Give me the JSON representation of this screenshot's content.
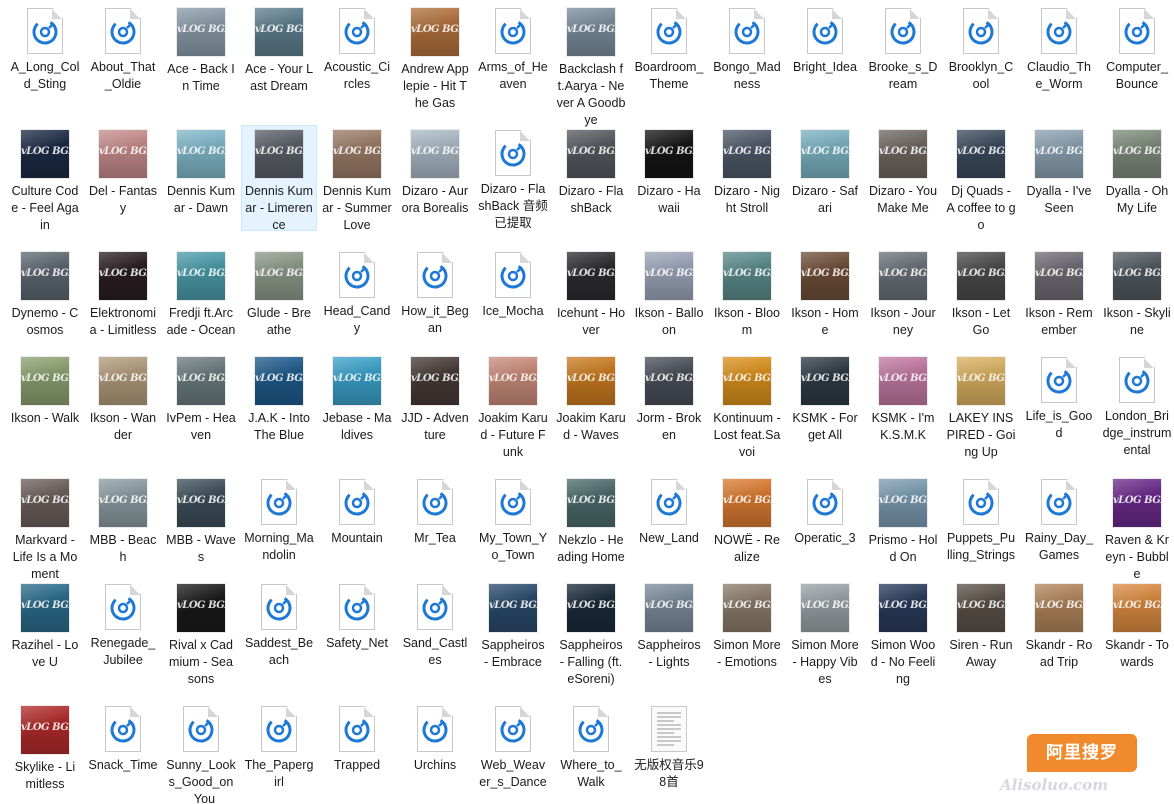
{
  "colors": {
    "selection": "#e5f3ff",
    "audio_icon": "#1e78d6",
    "watermark": "#f18a2c"
  },
  "watermark": {
    "text": "阿里搜罗",
    "sub": "Alisoluo.com"
  },
  "cover_watermark": "vLOG BGM",
  "files": [
    {
      "label": "A_Long_Cold_Sting",
      "icon": "audio-file-icon"
    },
    {
      "label": "About_That_Oldie",
      "icon": "audio-file-icon"
    },
    {
      "label": "Ace - Back In Time",
      "icon": "cover-thumbnail",
      "color": "#8a9aa8"
    },
    {
      "label": "Ace - Your Last Dream",
      "icon": "cover-thumbnail",
      "color": "#5d7d8c"
    },
    {
      "label": "Acoustic_Circles",
      "icon": "audio-file-icon"
    },
    {
      "label": "Andrew Applepie - Hit The Gas",
      "icon": "cover-thumbnail",
      "color": "#b0703c"
    },
    {
      "label": "Arms_of_Heaven",
      "icon": "audio-file-icon"
    },
    {
      "label": "Backclash ft.Aarya - Never A Goodbye",
      "icon": "cover-thumbnail",
      "color": "#7a8c9c"
    },
    {
      "label": "Boardroom_Theme",
      "icon": "audio-file-icon"
    },
    {
      "label": "Bongo_Madness",
      "icon": "audio-file-icon"
    },
    {
      "label": "Bright_Idea",
      "icon": "audio-file-icon"
    },
    {
      "label": "Brooke_s_Dream",
      "icon": "audio-file-icon"
    },
    {
      "label": "Brooklyn_Cool",
      "icon": "audio-file-icon"
    },
    {
      "label": "Claudio_The_Worm",
      "icon": "audio-file-icon"
    },
    {
      "label": "Computer_Bounce",
      "icon": "audio-file-icon"
    },
    {
      "label": "Culture Code - Feel Again",
      "icon": "cover-thumbnail",
      "color": "#1b2a44"
    },
    {
      "label": "Del - Fantasy",
      "icon": "cover-thumbnail",
      "color": "#c58a8a"
    },
    {
      "label": "Dennis Kumar - Dawn",
      "icon": "cover-thumbnail",
      "color": "#7fb6c8"
    },
    {
      "label": "Dennis Kumar - Limerence",
      "icon": "cover-thumbnail",
      "color": "#5a5e66",
      "selected": true
    },
    {
      "label": "Dennis Kumar - Summer Love",
      "icon": "cover-thumbnail",
      "color": "#9a7a66"
    },
    {
      "label": "Dizaro - Aurora Borealis",
      "icon": "cover-thumbnail",
      "color": "#a8b8c4"
    },
    {
      "label": "Dizaro - FlashBack 音频已提取",
      "icon": "audio-file-icon"
    },
    {
      "label": "Dizaro - FlashBack",
      "icon": "cover-thumbnail",
      "color": "#55585e"
    },
    {
      "label": "Dizaro - Hawaii",
      "icon": "cover-thumbnail",
      "color": "#151515"
    },
    {
      "label": "Dizaro - Night Stroll",
      "icon": "cover-thumbnail",
      "color": "#4d5868"
    },
    {
      "label": "Dizaro - Safari",
      "icon": "cover-thumbnail",
      "color": "#7ab0c0"
    },
    {
      "label": "Dizaro - YouMake Me",
      "icon": "cover-thumbnail",
      "color": "#6d6660"
    },
    {
      "label": "Dj Quads - A coffee to go",
      "icon": "cover-thumbnail",
      "color": "#3a4a5c"
    },
    {
      "label": "Dyalla - I've Seen",
      "icon": "cover-thumbnail",
      "color": "#8aa0b0"
    },
    {
      "label": "Dyalla - Oh My Life",
      "icon": "cover-thumbnail",
      "color": "#7c8a7a"
    },
    {
      "label": "Dynemo - Cosmos",
      "icon": "cover-thumbnail",
      "color": "#5c6670"
    },
    {
      "label": "Elektronomia - Limitless",
      "icon": "cover-thumbnail",
      "color": "#2a1e22"
    },
    {
      "label": "Fredji ft.Arcade - Ocean",
      "icon": "cover-thumbnail",
      "color": "#4a9aa8"
    },
    {
      "label": "Glude - Breathe",
      "icon": "cover-thumbnail",
      "color": "#8c9888"
    },
    {
      "label": "Head_Candy",
      "icon": "audio-file-icon"
    },
    {
      "label": "How_it_Began",
      "icon": "audio-file-icon"
    },
    {
      "label": "Ice_Mocha",
      "icon": "audio-file-icon"
    },
    {
      "label": "Icehunt - Hover",
      "icon": "cover-thumbnail",
      "color": "#2c2c30"
    },
    {
      "label": "Ikson - Balloon",
      "icon": "cover-thumbnail",
      "color": "#9aa4b8"
    },
    {
      "label": "Ikson - Bloom",
      "icon": "cover-thumbnail",
      "color": "#5a8a8a"
    },
    {
      "label": "Ikson - Home",
      "icon": "cover-thumbnail",
      "color": "#6e4e38"
    },
    {
      "label": "Ikson - Journey",
      "icon": "cover-thumbnail",
      "color": "#6a7078"
    },
    {
      "label": "Ikson - Let Go",
      "icon": "cover-thumbnail",
      "color": "#4a4a4a"
    },
    {
      "label": "Ikson - Remember",
      "icon": "cover-thumbnail",
      "color": "#6e6a74"
    },
    {
      "label": "Ikson - Skyline",
      "icon": "cover-thumbnail",
      "color": "#505860"
    },
    {
      "label": "Ikson - Walk",
      "icon": "cover-thumbnail",
      "color": "#8aa070"
    },
    {
      "label": "Ikson - Wander",
      "icon": "cover-thumbnail",
      "color": "#b09a7a"
    },
    {
      "label": "IvPem - Heaven",
      "icon": "cover-thumbnail",
      "color": "#6a7a7e"
    },
    {
      "label": "J.A.K - Into The Blue",
      "icon": "cover-thumbnail",
      "color": "#1e5a8a"
    },
    {
      "label": "Jebase - Maldives",
      "icon": "cover-thumbnail",
      "color": "#3aa0c8"
    },
    {
      "label": "JJD - Adventure",
      "icon": "cover-thumbnail",
      "color": "#463a36"
    },
    {
      "label": "Joakim Karud - Future Funk",
      "icon": "cover-thumbnail",
      "color": "#c88a7a"
    },
    {
      "label": "Joakim Karud - Waves",
      "icon": "cover-thumbnail",
      "color": "#c87a20"
    },
    {
      "label": "Jorm - Broken",
      "icon": "cover-thumbnail",
      "color": "#4a4e58"
    },
    {
      "label": "Kontinuum - Lost feat.Savoi",
      "icon": "cover-thumbnail",
      "color": "#d8901c"
    },
    {
      "label": "KSMK - Forget All",
      "icon": "cover-thumbnail",
      "color": "#2e3a44"
    },
    {
      "label": "KSMK - I'm K.S.M.K",
      "icon": "cover-thumbnail",
      "color": "#c078a0"
    },
    {
      "label": "LAKEY INSPIRED - Going Up",
      "icon": "cover-thumbnail",
      "color": "#d8b060"
    },
    {
      "label": "Life_is_Good",
      "icon": "audio-file-icon"
    },
    {
      "label": "London_Bridge_instrumental",
      "icon": "audio-file-icon"
    },
    {
      "label": "Markvard - Life Is a Moment",
      "icon": "cover-thumbnail",
      "color": "#6a5e5a"
    },
    {
      "label": "MBB - Beach",
      "icon": "cover-thumbnail",
      "color": "#8a9aa0"
    },
    {
      "label": "MBB - Waves",
      "icon": "cover-thumbnail",
      "color": "#3e4e5a"
    },
    {
      "label": "Morning_Mandolin",
      "icon": "audio-file-icon"
    },
    {
      "label": "Mountain",
      "icon": "audio-file-icon"
    },
    {
      "label": "Mr_Tea",
      "icon": "audio-file-icon"
    },
    {
      "label": "My_Town_Yo_Town",
      "icon": "audio-file-icon"
    },
    {
      "label": "Nekzlo - Heading Home",
      "icon": "cover-thumbnail",
      "color": "#4a6a6a"
    },
    {
      "label": "New_Land",
      "icon": "audio-file-icon"
    },
    {
      "label": "NOWË - Realize",
      "icon": "cover-thumbnail",
      "color": "#d87a30"
    },
    {
      "label": "Operatic_3",
      "icon": "audio-file-icon"
    },
    {
      "label": "Prismo - Hold On",
      "icon": "cover-thumbnail",
      "color": "#7a9ab0"
    },
    {
      "label": "Puppets_Pulling_Strings",
      "icon": "audio-file-icon"
    },
    {
      "label": "Rainy_Day_Games",
      "icon": "audio-file-icon"
    },
    {
      "label": "Raven & Kreyn - Bubble",
      "icon": "cover-thumbnail",
      "color": "#6a2a8a"
    },
    {
      "label": "Razihel - Love U",
      "icon": "cover-thumbnail",
      "color": "#2a6a8a"
    },
    {
      "label": "Renegade_Jubilee",
      "icon": "audio-file-icon"
    },
    {
      "label": "Rival x Cadmium - Seasons",
      "icon": "cover-thumbnail",
      "color": "#1a1a1a"
    },
    {
      "label": "Saddest_Beach",
      "icon": "audio-file-icon"
    },
    {
      "label": "Safety_Net",
      "icon": "audio-file-icon"
    },
    {
      "label": "Sand_Castles",
      "icon": "audio-file-icon"
    },
    {
      "label": "Sappheiros - Embrace",
      "icon": "cover-thumbnail",
      "color": "#2a4a6a"
    },
    {
      "label": "Sappheiros - Falling (ft. eSoreni)",
      "icon": "cover-thumbnail",
      "color": "#1a2a3a"
    },
    {
      "label": "Sappheiros - Lights",
      "icon": "cover-thumbnail",
      "color": "#7a8a9a"
    },
    {
      "label": "Simon More - Emotions",
      "icon": "cover-thumbnail",
      "color": "#8a7a6a"
    },
    {
      "label": "Simon More - Happy Vibes",
      "icon": "cover-thumbnail",
      "color": "#9aa0a4"
    },
    {
      "label": "Simon Wood - No Feeling",
      "icon": "cover-thumbnail",
      "color": "#2a3a5a"
    },
    {
      "label": "Siren - Run Away",
      "icon": "cover-thumbnail",
      "color": "#5a5048"
    },
    {
      "label": "Skandr - Road Trip",
      "icon": "cover-thumbnail",
      "color": "#b0845a"
    },
    {
      "label": "Skandr - Towards",
      "icon": "cover-thumbnail",
      "color": "#d88a40"
    },
    {
      "label": "Skylike - Limitless",
      "icon": "cover-thumbnail",
      "color": "#b02a2a"
    },
    {
      "label": "Snack_Time",
      "icon": "audio-file-icon"
    },
    {
      "label": "Sunny_Looks_Good_on_You",
      "icon": "audio-file-icon"
    },
    {
      "label": "The_Papergirl",
      "icon": "audio-file-icon"
    },
    {
      "label": "Trapped",
      "icon": "audio-file-icon"
    },
    {
      "label": "Urchins",
      "icon": "audio-file-icon"
    },
    {
      "label": "Web_Weaver_s_Dance",
      "icon": "audio-file-icon"
    },
    {
      "label": "Where_to_Walk",
      "icon": "audio-file-icon"
    },
    {
      "label": "无版权音乐98首",
      "icon": "text-file-icon"
    }
  ]
}
